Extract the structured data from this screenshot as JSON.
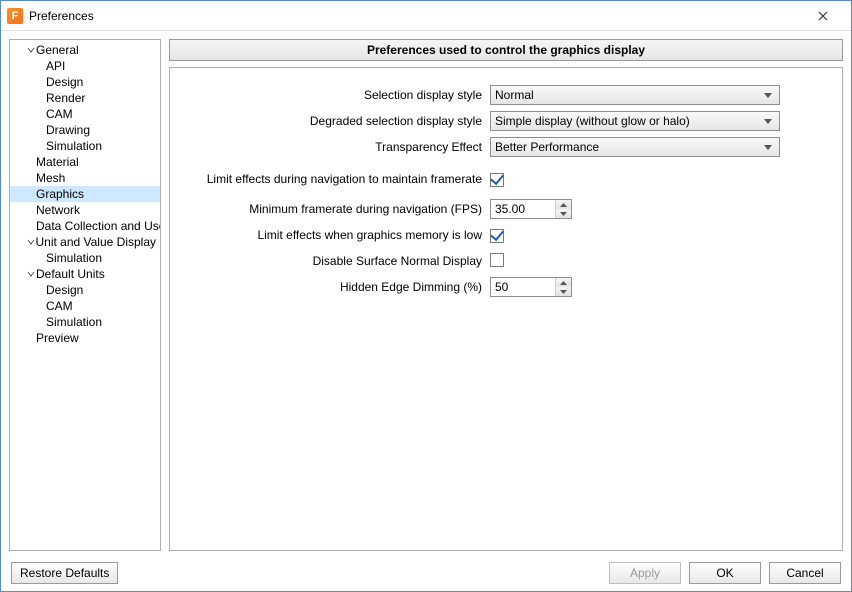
{
  "window": {
    "title": "Preferences",
    "app_icon_letter": "F"
  },
  "sidebar": {
    "items": [
      {
        "label": "General",
        "level": 1,
        "expandable": true
      },
      {
        "label": "API",
        "level": 2
      },
      {
        "label": "Design",
        "level": 2
      },
      {
        "label": "Render",
        "level": 2
      },
      {
        "label": "CAM",
        "level": 2
      },
      {
        "label": "Drawing",
        "level": 2
      },
      {
        "label": "Simulation",
        "level": 2
      },
      {
        "label": "Material",
        "level": 1
      },
      {
        "label": "Mesh",
        "level": 1
      },
      {
        "label": "Graphics",
        "level": 1,
        "selected": true
      },
      {
        "label": "Network",
        "level": 1
      },
      {
        "label": "Data Collection and Use",
        "level": 1
      },
      {
        "label": "Unit and Value Display",
        "level": 1,
        "expandable": true
      },
      {
        "label": "Simulation",
        "level": 2
      },
      {
        "label": "Default Units",
        "level": 1,
        "expandable": true
      },
      {
        "label": "Design",
        "level": 2
      },
      {
        "label": "CAM",
        "level": 2
      },
      {
        "label": "Simulation",
        "level": 2
      },
      {
        "label": "Preview",
        "level": 1
      }
    ]
  },
  "main": {
    "header": "Preferences used to control the graphics display",
    "rows": {
      "selection_style": {
        "label": "Selection display style",
        "value": "Normal"
      },
      "degraded_style": {
        "label": "Degraded selection display style",
        "value": "Simple display (without glow or halo)"
      },
      "transparency": {
        "label": "Transparency Effect",
        "value": "Better Performance"
      },
      "limit_nav": {
        "label": "Limit effects during navigation to maintain framerate",
        "checked": true
      },
      "min_fps": {
        "label": "Minimum framerate during navigation (FPS)",
        "value": "35.00"
      },
      "limit_mem": {
        "label": "Limit effects when graphics memory is low",
        "checked": true
      },
      "disable_normal": {
        "label": "Disable Surface Normal Display",
        "checked": false
      },
      "hidden_edge": {
        "label": "Hidden Edge Dimming (%)",
        "value": "50"
      }
    }
  },
  "footer": {
    "restore": "Restore Defaults",
    "apply": "Apply",
    "ok": "OK",
    "cancel": "Cancel"
  }
}
